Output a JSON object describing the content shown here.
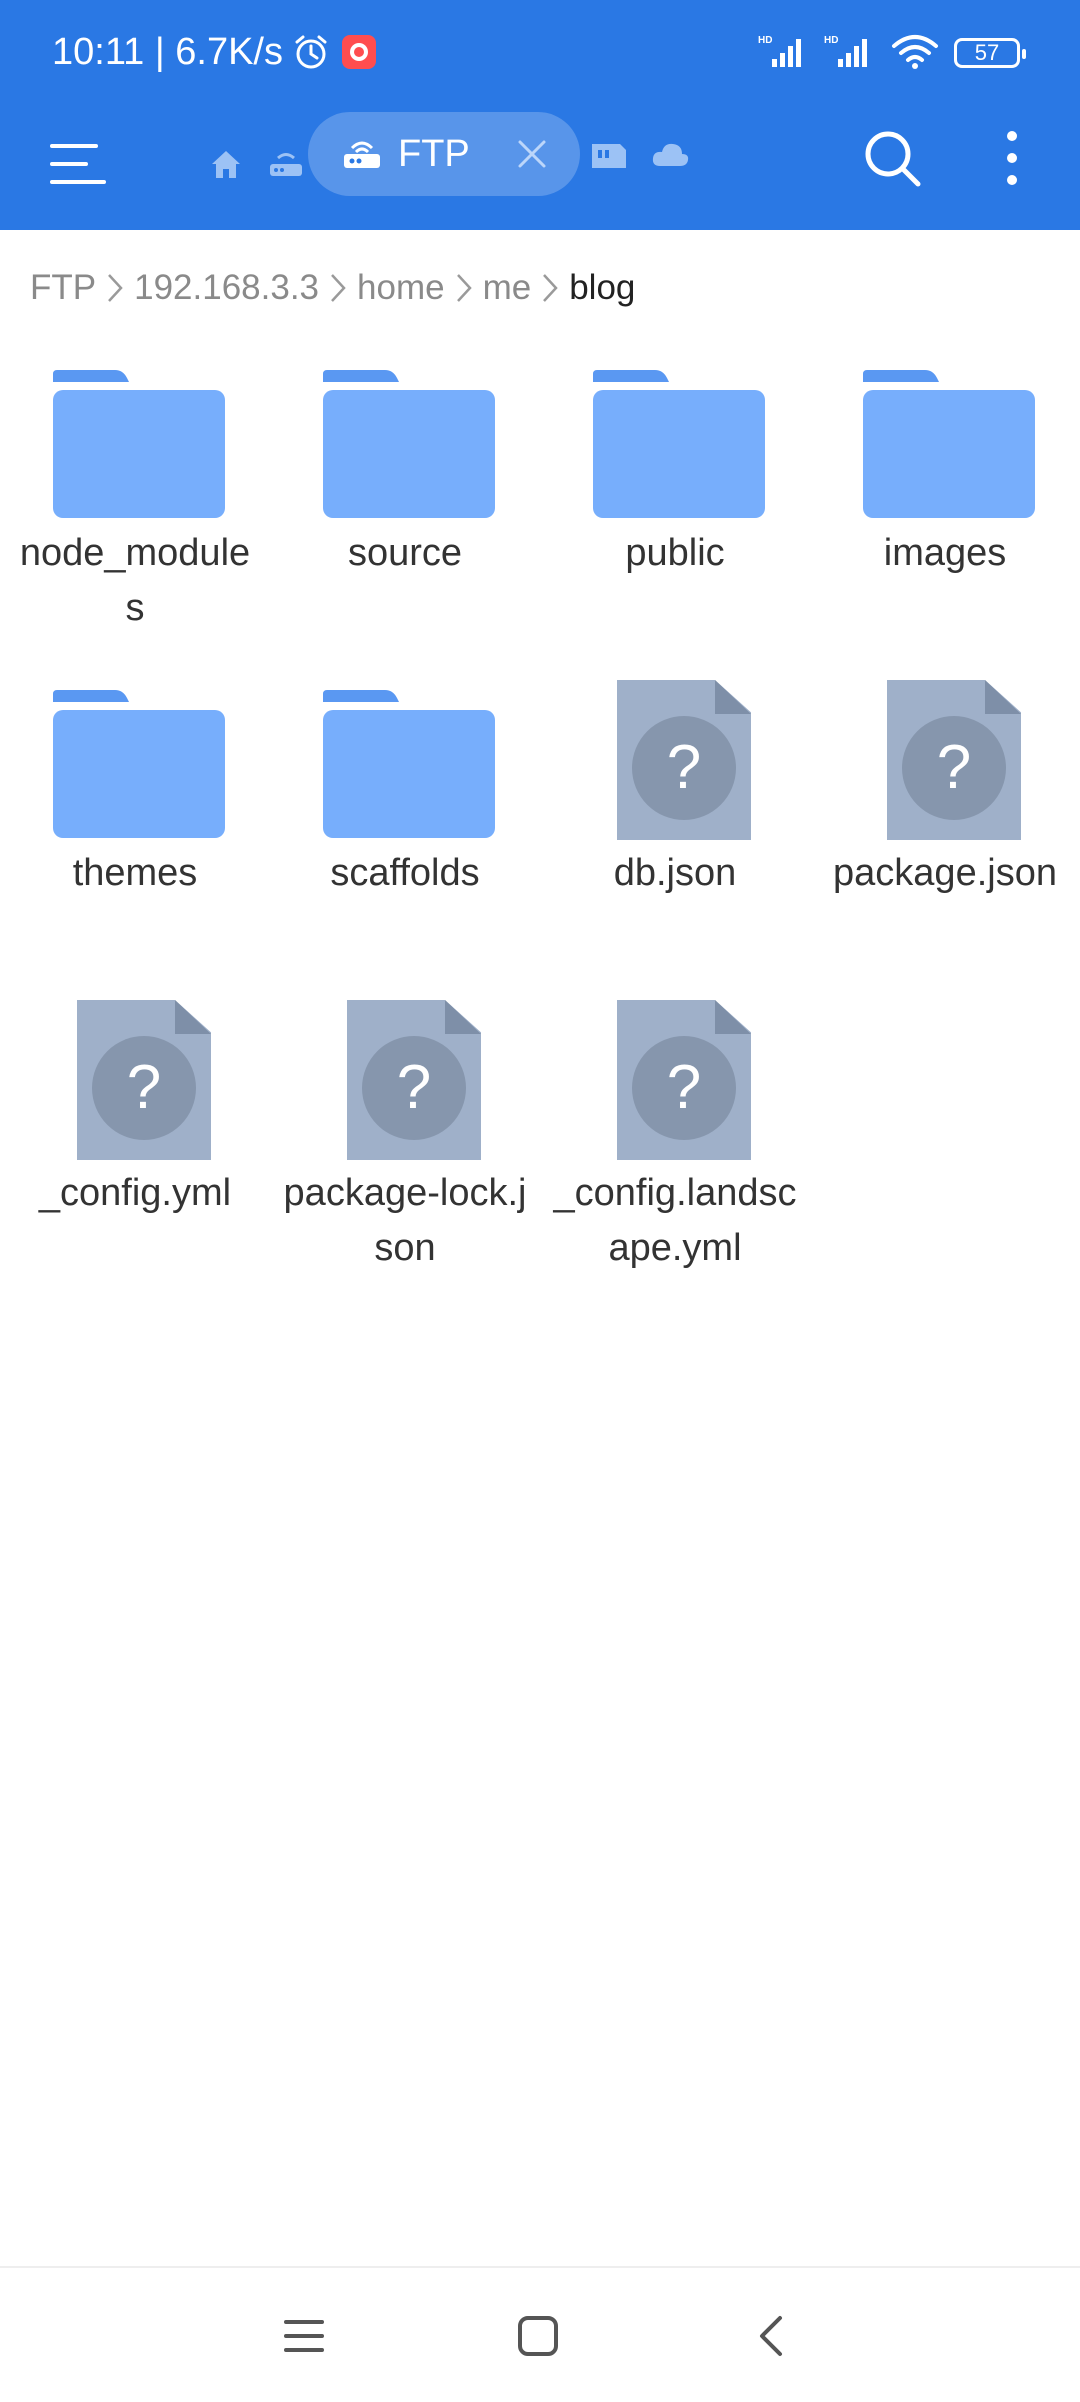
{
  "status_bar": {
    "time_speed": "10:11 | 6.7K/s",
    "battery": "57",
    "icons": [
      "alarm-icon",
      "record-icon",
      "signal-hd-icon",
      "signal-hd-icon",
      "wifi-icon",
      "battery-icon"
    ]
  },
  "toolbar": {
    "active_tab_label": "FTP",
    "icons": [
      "menu-icon",
      "home-icon",
      "router-icon",
      "network-icon",
      "close-icon",
      "storage-icon",
      "cloud-icon",
      "search-icon",
      "more-vert-icon"
    ]
  },
  "breadcrumb": [
    "FTP",
    "192.168.3.3",
    "home",
    "me",
    "blog"
  ],
  "files": [
    {
      "name": "node_modules",
      "type": "folder"
    },
    {
      "name": "source",
      "type": "folder"
    },
    {
      "name": "public",
      "type": "folder"
    },
    {
      "name": "images",
      "type": "folder"
    },
    {
      "name": "themes",
      "type": "folder"
    },
    {
      "name": "scaffolds",
      "type": "folder"
    },
    {
      "name": "db.json",
      "type": "file"
    },
    {
      "name": "package.json",
      "type": "file"
    },
    {
      "name": "_config.yml",
      "type": "file"
    },
    {
      "name": "package-lock.json",
      "type": "file"
    },
    {
      "name": "_config.landscape.yml",
      "type": "file"
    }
  ],
  "colors": {
    "accent": "#2a78e4",
    "folder": "#77aefc",
    "folder_tab": "#5a98f2",
    "unknown_file": "#9fb0c9"
  },
  "navbar": [
    "recents-icon",
    "home-square-icon",
    "back-icon"
  ]
}
